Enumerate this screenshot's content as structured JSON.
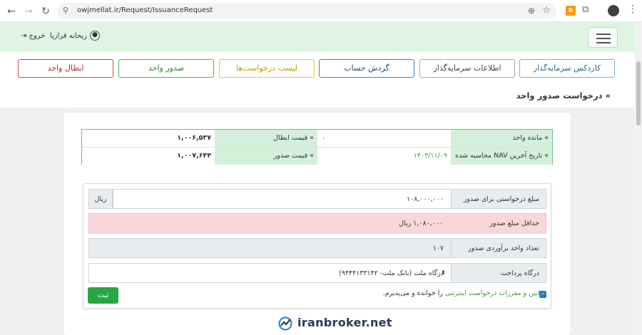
{
  "browser": {
    "url": "owjmellat.ir/Request/IssuanceRequest",
    "extension_letter": "a"
  },
  "header": {
    "user_name": "ریحانه فرازیا",
    "logout_label": "خروج"
  },
  "nav": {
    "buttons": [
      {
        "label": "کاردکس سرمایه‌گذار",
        "color": "#6fb8c8"
      },
      {
        "label": "اطلاعات سرمایه‌گذار",
        "color": "#aaaaaa"
      },
      {
        "label": "گردش حساب",
        "color": "#4d7fb8"
      },
      {
        "label": "لیست درخواست‌ها",
        "color": "#e9c548"
      },
      {
        "label": "صدور واحد",
        "color": "#5aa95a"
      },
      {
        "label": "ابطال واحد",
        "color": "#c94a4a"
      }
    ]
  },
  "page_title": "» درخواست صدور واحد",
  "info": {
    "remaining_units_label": "» مانده واحد",
    "remaining_units_value": "۰",
    "cancel_price_label": "» قیمت ابطال",
    "cancel_price_value": "۱,۰۰۶,۵۳۷",
    "nav_date_label": "» تاریخ آخرین NAV محاسبه شده",
    "nav_date_value": "۱۴۰۳/۱۱/۰۹",
    "issue_price_label": "» قیمت صدور",
    "issue_price_value": "۱,۰۰۷,۶۴۴"
  },
  "form": {
    "amount_label": "مبلغ درخواستی برای صدور",
    "amount_value": "۱۰۸,۰۰۰,۰۰۰",
    "amount_unit": "ریال",
    "min_label": "حداقل مبلغ صدور",
    "min_value": "۱,۰۸۰,۰۰۰ ریال",
    "est_label": "تعداد واحد برآوردی صدور",
    "est_value": "۱۰۷",
    "gateway_label": "درگاه پرداخت",
    "gateway_value": "درگاه ملت (بانک ملت- ۹۴۴۴۱۳۳۱۴۲)",
    "terms_link": "قوانین و مقررات درخواست اینترنتی",
    "terms_rest": " را خوانده و می‌پذیرم.",
    "terms_checked": true,
    "submit_label": "ثبت"
  },
  "watermark": {
    "text": "iranbroker.net"
  },
  "colors": {
    "header_bg": "#dff5e1",
    "info_label_bg": "#d4f0d9",
    "min_row_bg": "#f8d7da",
    "submit_bg": "#28a745"
  }
}
